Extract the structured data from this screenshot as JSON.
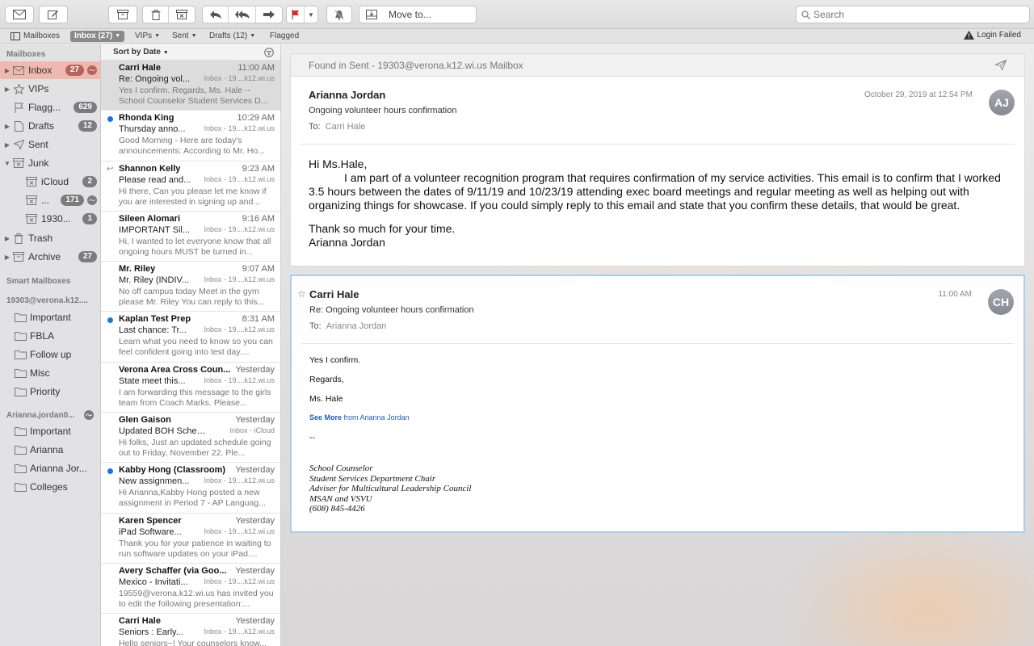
{
  "toolbar": {
    "move_to_label": "Move to...",
    "search_placeholder": "Search"
  },
  "favorites": {
    "mailboxes": "Mailboxes",
    "inbox": "Inbox (27)",
    "vips": "VIPs",
    "sent": "Sent",
    "drafts": "Drafts (12)",
    "flagged": "Flagged",
    "login_failed": "Login Failed"
  },
  "sidebar": {
    "mailboxes_header": "Mailboxes",
    "inbox": {
      "label": "Inbox",
      "count": "27"
    },
    "vips": {
      "label": "VIPs"
    },
    "flagged": {
      "label": "Flagg...",
      "count": "629"
    },
    "drafts": {
      "label": "Drafts",
      "count": "12"
    },
    "sent": {
      "label": "Sent"
    },
    "junk": {
      "label": "Junk"
    },
    "junk_icloud": {
      "label": "iCloud",
      "count": "2"
    },
    "junk_other": {
      "label": "...",
      "count": "171"
    },
    "junk_1930": {
      "label": "1930...",
      "count": "1"
    },
    "trash": {
      "label": "Trash"
    },
    "archive": {
      "label": "Archive",
      "count": "27"
    },
    "smart_header": "Smart Mailboxes",
    "account1": "19303@verona.k12....",
    "account1_folders": [
      "Important",
      "FBLA",
      "Follow up",
      "Misc",
      "Priority"
    ],
    "account2": "Arianna.jordan0...",
    "account2_folders": [
      "Important",
      "Arianna",
      "Arianna Jor...",
      "Colleges"
    ]
  },
  "list": {
    "sort_label": "Sort by Date",
    "messages": [
      {
        "sender": "Carri Hale",
        "time": "11:00 AM",
        "subject": "Re: Ongoing vol...",
        "mailbox": "Inbox - 19....k12.wi.us",
        "preview": "Yes I confirm. Regards, Ms. Hale -- School Counselor Student Services D..."
      },
      {
        "sender": "Rhonda King",
        "time": "10:29 AM",
        "subject": "Thursday anno...",
        "mailbox": "Inbox - 19....k12.wi.us",
        "preview": "Good Morning -  Here are today's announcements: According to Mr. Ho..."
      },
      {
        "sender": "Shannon Kelly",
        "time": "9:23 AM",
        "subject": "Please read and...",
        "mailbox": "Inbox - 19....k12.wi.us",
        "preview": "Hi there, Can you please let me know if you are interested in signing up and..."
      },
      {
        "sender": "Sileen Alomari",
        "time": "9:16 AM",
        "subject": "IMPORTANT Sil...",
        "mailbox": "Inbox - 19....k12.wi.us",
        "preview": "Hi, I wanted to let everyone know that all ongoing hours MUST be turned in..."
      },
      {
        "sender": "Mr. Riley",
        "time": "9:07 AM",
        "subject": "Mr. Riley (INDIV...",
        "mailbox": "Inbox - 19....k12.wi.us",
        "preview": "No off campus today Meet in the gym please Mr. Riley You can reply to this..."
      },
      {
        "sender": "Kaplan Test Prep",
        "time": "8:31 AM",
        "subject": "Last chance: Tr...",
        "mailbox": "Inbox - 19....k12.wi.us",
        "preview": "Learn what you need to know so you can feel confident going into test day...."
      },
      {
        "sender": "Verona Area Cross Coun...",
        "time": "Yesterday",
        "subject": "State meet this...",
        "mailbox": "Inbox - 19....k12.wi.us",
        "preview": "I am forwarding this message to the girls team from Coach Marks. Please..."
      },
      {
        "sender": "Glen Gaison",
        "time": "Yesterday",
        "subject": "Updated BOH Schedul...",
        "mailbox": "Inbox - iCloud",
        "preview": "Hi folks, Just an updated schedule going out to Friday, November 22. Ple..."
      },
      {
        "sender": "Kabby Hong (Classroom)",
        "time": "Yesterday",
        "subject": "New assignmen...",
        "mailbox": "Inbox - 19....k12.wi.us",
        "preview": "Hi Arianna,Kabby Hong posted a new assignment in Period 7 - AP Languag..."
      },
      {
        "sender": "Karen Spencer",
        "time": "Yesterday",
        "subject": "iPad Software...",
        "mailbox": "Inbox - 19....k12.wi.us",
        "preview": "Thank you for your patience in waiting to run software updates on your iPad...."
      },
      {
        "sender": "Avery Schaffer (via Goo...",
        "time": "Yesterday",
        "subject": "Mexico - Invitati...",
        "mailbox": "Inbox - 19....k12.wi.us",
        "preview": "19559@verona.k12.wi.us has invited you to edit the following presentation:..."
      },
      {
        "sender": "Carri Hale",
        "time": "Yesterday",
        "subject": "Seniors : Early...",
        "mailbox": "Inbox - 19....k12.wi.us",
        "preview": "Hello seniors~! Your counselors know..."
      }
    ]
  },
  "reading": {
    "found_in": "Found in Sent - 19303@verona.k12.wi.us Mailbox",
    "email1": {
      "from": "Arianna Jordan",
      "subject": "Ongoing volunteer hours confirmation",
      "to_label": "To:",
      "to": "Carri Hale",
      "date": "October 29, 2019 at 12:54 PM",
      "initials": "AJ",
      "greeting": "Hi Ms.Hale,",
      "paragraph": "I am part of a volunteer recognition program that requires confirmation of my service activities. This email is to confirm that I worked 3.5  hours between the dates of  9/11/19  and 10/23/19 attending exec board meetings and regular meeting as well as helping out with organizing things for showcase. If you could simply reply to this email and state that you confirm these details, that would be great.",
      "thanks": "Thank so much for your time.",
      "signature": "Arianna Jordan"
    },
    "email2": {
      "from": "Carri Hale",
      "subject": "Re: Ongoing volunteer hours confirmation",
      "to_label": "To:",
      "to": "Arianna Jordan",
      "date": "11:00 AM",
      "initials": "CH",
      "line1": "Yes I confirm.",
      "line2": "Regards,",
      "line3": "Ms. Hale",
      "see_more": "See More",
      "see_more_from": "from Arianna Jordan",
      "dashes": "--",
      "sig": [
        "School Counselor",
        "Student Services Department Chair",
        "Adviser for Multicultural Leadership Council",
        "MSAN and VSVU",
        "(608) 845-4426"
      ]
    }
  }
}
